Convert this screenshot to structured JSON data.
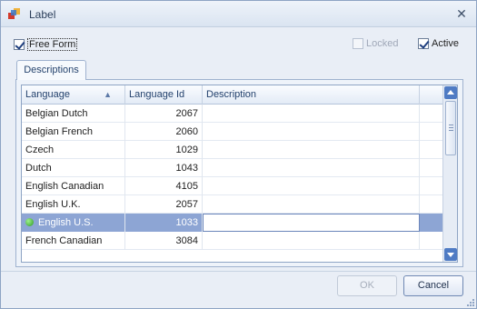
{
  "window": {
    "title": "Label"
  },
  "options": {
    "free_form": {
      "label": "Free Form",
      "checked": true
    },
    "locked": {
      "label": "Locked",
      "checked": false,
      "disabled": true
    },
    "active": {
      "label": "Active",
      "checked": true
    }
  },
  "tabs": [
    {
      "label": "Descriptions",
      "selected": true
    }
  ],
  "grid": {
    "columns": [
      "Language",
      "Language Id",
      "Description"
    ],
    "sort_column": "Language",
    "sort_direction": "ascending",
    "rows": [
      {
        "language": "Belgian Dutch",
        "id": "2067",
        "description": ""
      },
      {
        "language": "Belgian French",
        "id": "2060",
        "description": ""
      },
      {
        "language": "Czech",
        "id": "1029",
        "description": ""
      },
      {
        "language": "Dutch",
        "id": "1043",
        "description": ""
      },
      {
        "language": "English Canadian",
        "id": "4105",
        "description": ""
      },
      {
        "language": "English U.K.",
        "id": "2057",
        "description": ""
      },
      {
        "language": "English U.S.",
        "id": "1033",
        "description": "",
        "selected": true,
        "indicator": "green-dot"
      },
      {
        "language": "French Canadian",
        "id": "3084",
        "description": ""
      }
    ]
  },
  "buttons": {
    "ok": "OK",
    "cancel": "Cancel"
  },
  "colors": {
    "selection": "#8da5d4",
    "scroll_button": "#4f7bc4",
    "frame": "#8ea4c4"
  }
}
